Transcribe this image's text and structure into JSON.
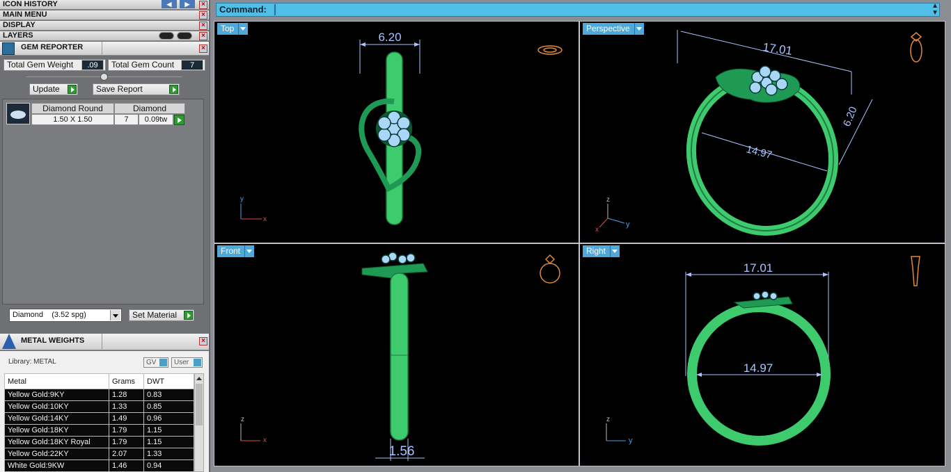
{
  "left_panel": {
    "menu_rows": [
      {
        "label": "ICON HISTORY"
      },
      {
        "label": "MAIN MENU"
      },
      {
        "label": "DISPLAY"
      },
      {
        "label": "LAYERS"
      }
    ],
    "gem_reporter": {
      "title": "GEM REPORTER",
      "total_weight_label": "Total Gem Weight",
      "total_weight_value": ".09",
      "total_count_label": "Total Gem Count",
      "total_count_value": "7",
      "update_label": "Update",
      "save_report_label": "Save Report",
      "gem": {
        "shape_header": "Diamond Round",
        "material_header": "Diamond",
        "size": "1.50 X 1.50",
        "count": "7",
        "weight": "0.09tw"
      },
      "material_select": "Diamond    (3.52 spg)",
      "set_material_label": "Set Material"
    },
    "metal_weights": {
      "title": "METAL WEIGHTS",
      "library_label": "Library: METAL",
      "gv_label": "GV",
      "user_label": "User",
      "columns": [
        "Metal",
        "Grams",
        "DWT"
      ],
      "rows": [
        [
          "Yellow Gold:9KY",
          "1.28",
          "0.83"
        ],
        [
          "Yellow Gold:10KY",
          "1.33",
          "0.85"
        ],
        [
          "Yellow Gold:14KY",
          "1.49",
          "0.96"
        ],
        [
          "Yellow Gold:18KY",
          "1.79",
          "1.15"
        ],
        [
          "Yellow Gold:18KY Royal",
          "1.79",
          "1.15"
        ],
        [
          "Yellow Gold:22KY",
          "2.07",
          "1.33"
        ],
        [
          "White Gold:9KW",
          "1.46",
          "0.94"
        ]
      ]
    }
  },
  "command": {
    "label": "Command:",
    "value": ""
  },
  "viewports": {
    "top": {
      "label": "Top",
      "dim": "6.20"
    },
    "perspective": {
      "label": "Perspective",
      "dim_a": "17.01",
      "dim_b": "6.20",
      "dim_c": "14.97"
    },
    "front": {
      "label": "Front",
      "dim": "1.56"
    },
    "right": {
      "label": "Right",
      "dim_a": "17.01",
      "dim_b": "14.97"
    }
  },
  "axes": {
    "x": "x",
    "y": "y",
    "z": "z"
  },
  "colors": {
    "metal": "#3ecb6e",
    "metal_dark": "#1f7a45",
    "gem": "#a9d7f5",
    "dimension": "#a8c4ff",
    "accent": "#4fa8d8"
  }
}
